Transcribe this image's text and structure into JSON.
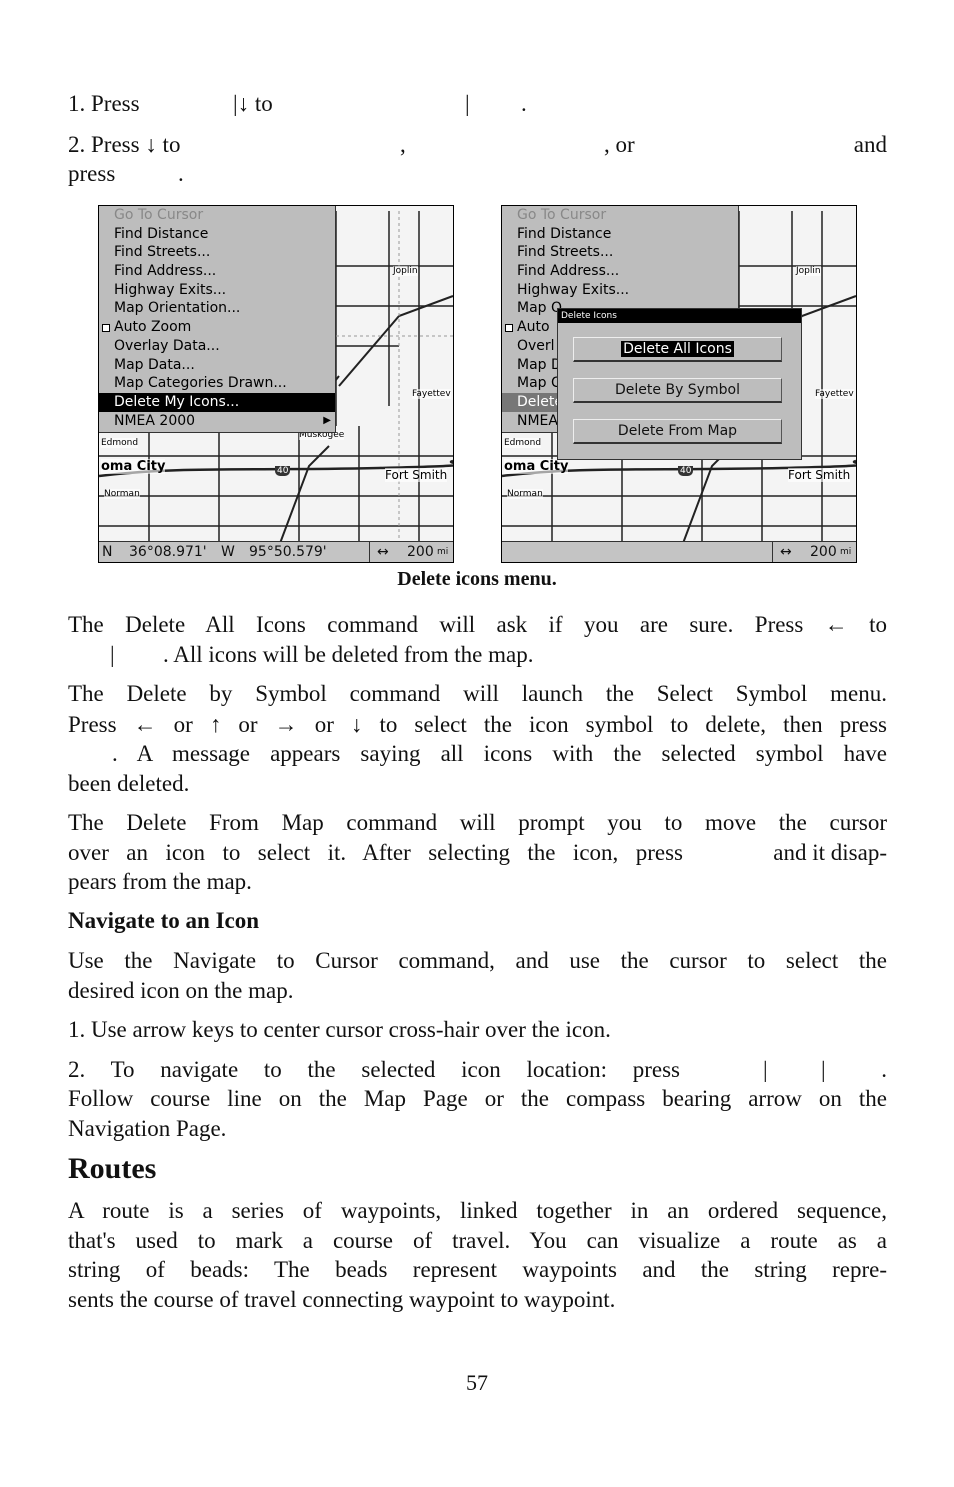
{
  "steps_top": {
    "line1": {
      "a": "1. Press",
      "b": "|↓ to",
      "c": "|",
      "d": "."
    },
    "line2": {
      "a": "2. Press ↓ to",
      "b": ",",
      "c": ", or",
      "d": "and"
    },
    "line3": {
      "a": "press",
      "b": "."
    }
  },
  "screens": {
    "menu_items": [
      {
        "label": "Go To Cursor",
        "state": "disabled"
      },
      {
        "label": "Find Distance"
      },
      {
        "label": "Find Streets..."
      },
      {
        "label": "Find Address..."
      },
      {
        "label": "Highway Exits..."
      },
      {
        "label": "Map Orientation..."
      },
      {
        "label": "Auto Zoom",
        "checkbox": true
      },
      {
        "label": "Overlay Data..."
      },
      {
        "label": "Map Data..."
      },
      {
        "label": "Map Categories Drawn..."
      },
      {
        "label": "Delete My Icons...",
        "state": "selected"
      },
      {
        "label": "NMEA 2000",
        "submenu": true
      }
    ],
    "right_menu_visible": [
      "Go To Cursor",
      "Find Distance",
      "Find Streets...",
      "Find Address...",
      "Highway Exits...",
      "Map O",
      "Auto",
      "Overl",
      "Map D",
      "Map C",
      "Delete",
      "NMEA"
    ],
    "map_labels": {
      "joplin": "Joplin",
      "fayetteville": "Fayettev",
      "edmond": "Edmond",
      "okc": "oma City",
      "norman": "Norman",
      "fort_smith": "Fort Smith",
      "muskogee": "Muskogee",
      "interstate": "40"
    },
    "status": {
      "lat_hemi": "N",
      "lat": "36°08.971'",
      "lon_hemi": "W",
      "lon": "95°50.579'",
      "zoom_icon": "left-right-arrow-icon",
      "zoom": "200",
      "zoom_unit": "mi"
    },
    "dialog": {
      "title": "Delete Icons",
      "buttons": [
        "Delete All Icons",
        "Delete By Symbol",
        "Delete From Map"
      ],
      "selected": 0
    }
  },
  "caption": "Delete icons menu.",
  "paragraphs": {
    "p1_l1": "The Delete All Icons command will ask if you are sure. Press ← to",
    "p1_l2a": "|",
    "p1_l2b": ". All icons will be deleted from the map.",
    "p2_l1": "The Delete by Symbol command will launch the Select Symbol menu.",
    "p2_l2": "Press ← or ↑ or → or ↓ to select the icon symbol to delete, then press",
    "p2_l3": ". A message appears saying all icons with the selected symbol have",
    "p2_l4": "been deleted.",
    "p3_l1": "The Delete From Map command will prompt you to move the cursor",
    "p3_l2a": "over an icon to select it. After selecting the icon, press",
    "p3_l2b": "and it disap-",
    "p3_l3": "pears from the map."
  },
  "navigate": {
    "heading": "Navigate to an Icon",
    "p_l1": "Use the Navigate to Cursor command, and use the cursor to select the",
    "p_l2": "desired icon on the map.",
    "step1": "1. Use arrow keys to center cursor cross-hair over the icon.",
    "step2a": "2. To navigate to the selected icon location: press",
    "step2b": "|",
    "step2c": "|",
    "step2d": ".",
    "step2_l2": "Follow course line on the Map Page or the compass bearing arrow on the",
    "step2_l3": "Navigation Page."
  },
  "routes": {
    "heading": "Routes",
    "l1": "A route is a series of waypoints, linked together in an ordered sequence,",
    "l2": "that's used to mark a course of travel. You can visualize a route as a",
    "l3": "string of beads: The beads represent waypoints and the string repre-",
    "l4": "sents the course of travel connecting waypoint to waypoint."
  },
  "page_number": "57"
}
